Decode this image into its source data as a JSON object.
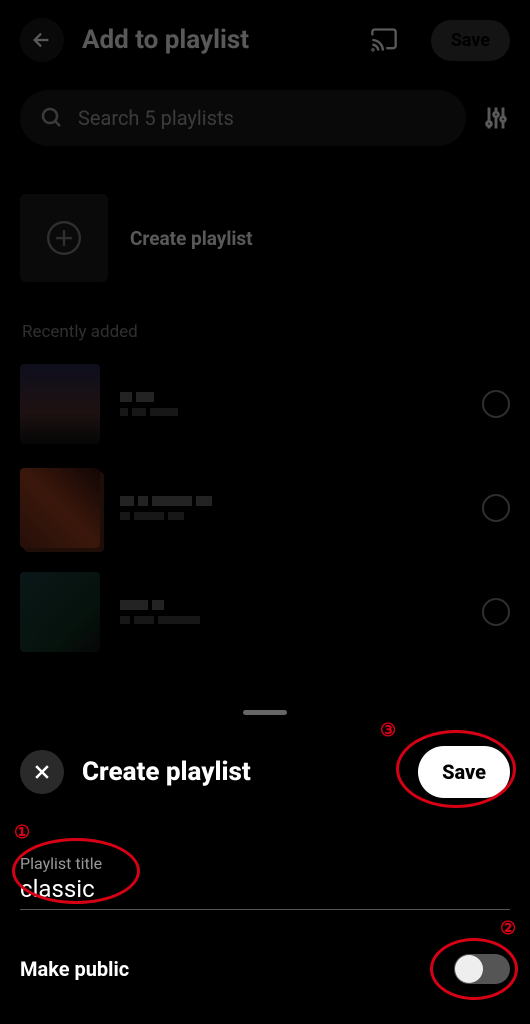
{
  "header": {
    "title": "Add to playlist",
    "save_label": "Save"
  },
  "search": {
    "placeholder": "Search 5 playlists"
  },
  "create_row": {
    "label": "Create playlist"
  },
  "section_title": "Recently added",
  "modal": {
    "title": "Create playlist",
    "save_label": "Save",
    "field_label": "Playlist title",
    "field_value": "classic",
    "public_label": "Make public"
  },
  "annotations": {
    "n1": "①",
    "n2": "②",
    "n3": "③"
  }
}
